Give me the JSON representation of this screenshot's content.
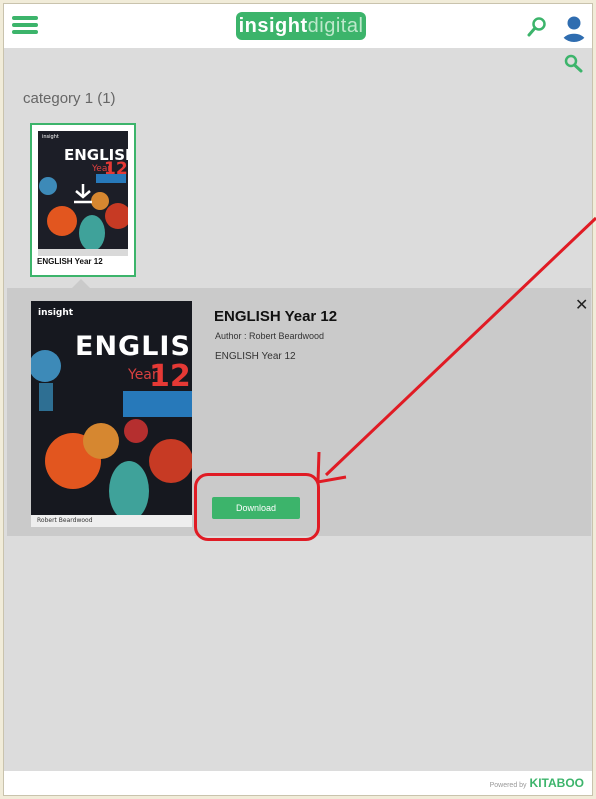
{
  "header": {
    "logo_part1": "insight",
    "logo_part2": "digital",
    "colors": {
      "brand_green": "#3cb46b",
      "avatar_blue": "#2f6db0"
    },
    "icons": [
      "menu-icon",
      "search-icon",
      "user-avatar-icon"
    ]
  },
  "category": {
    "title": "category 1 (1)"
  },
  "thumbnail": {
    "cover_brand": "insight",
    "cover_title": "ENGLISH",
    "cover_year_word": "Year",
    "cover_year_num": "12",
    "caption": "ENGLISH Year 12"
  },
  "detail": {
    "cover_brand": "insight",
    "cover_title": "ENGLISH",
    "cover_year_word": "Year",
    "cover_year_num": "12",
    "cover_author": "Robert Beardwood",
    "title": "ENGLISH Year 12",
    "author": "Author : Robert Beardwood",
    "description": "ENGLISH Year 12",
    "close_symbol": "✕",
    "download_label": "Download"
  },
  "footer": {
    "powered_by": "Powered by",
    "brand": "KITABOO"
  },
  "annotation": {
    "color": "#e01b24"
  }
}
